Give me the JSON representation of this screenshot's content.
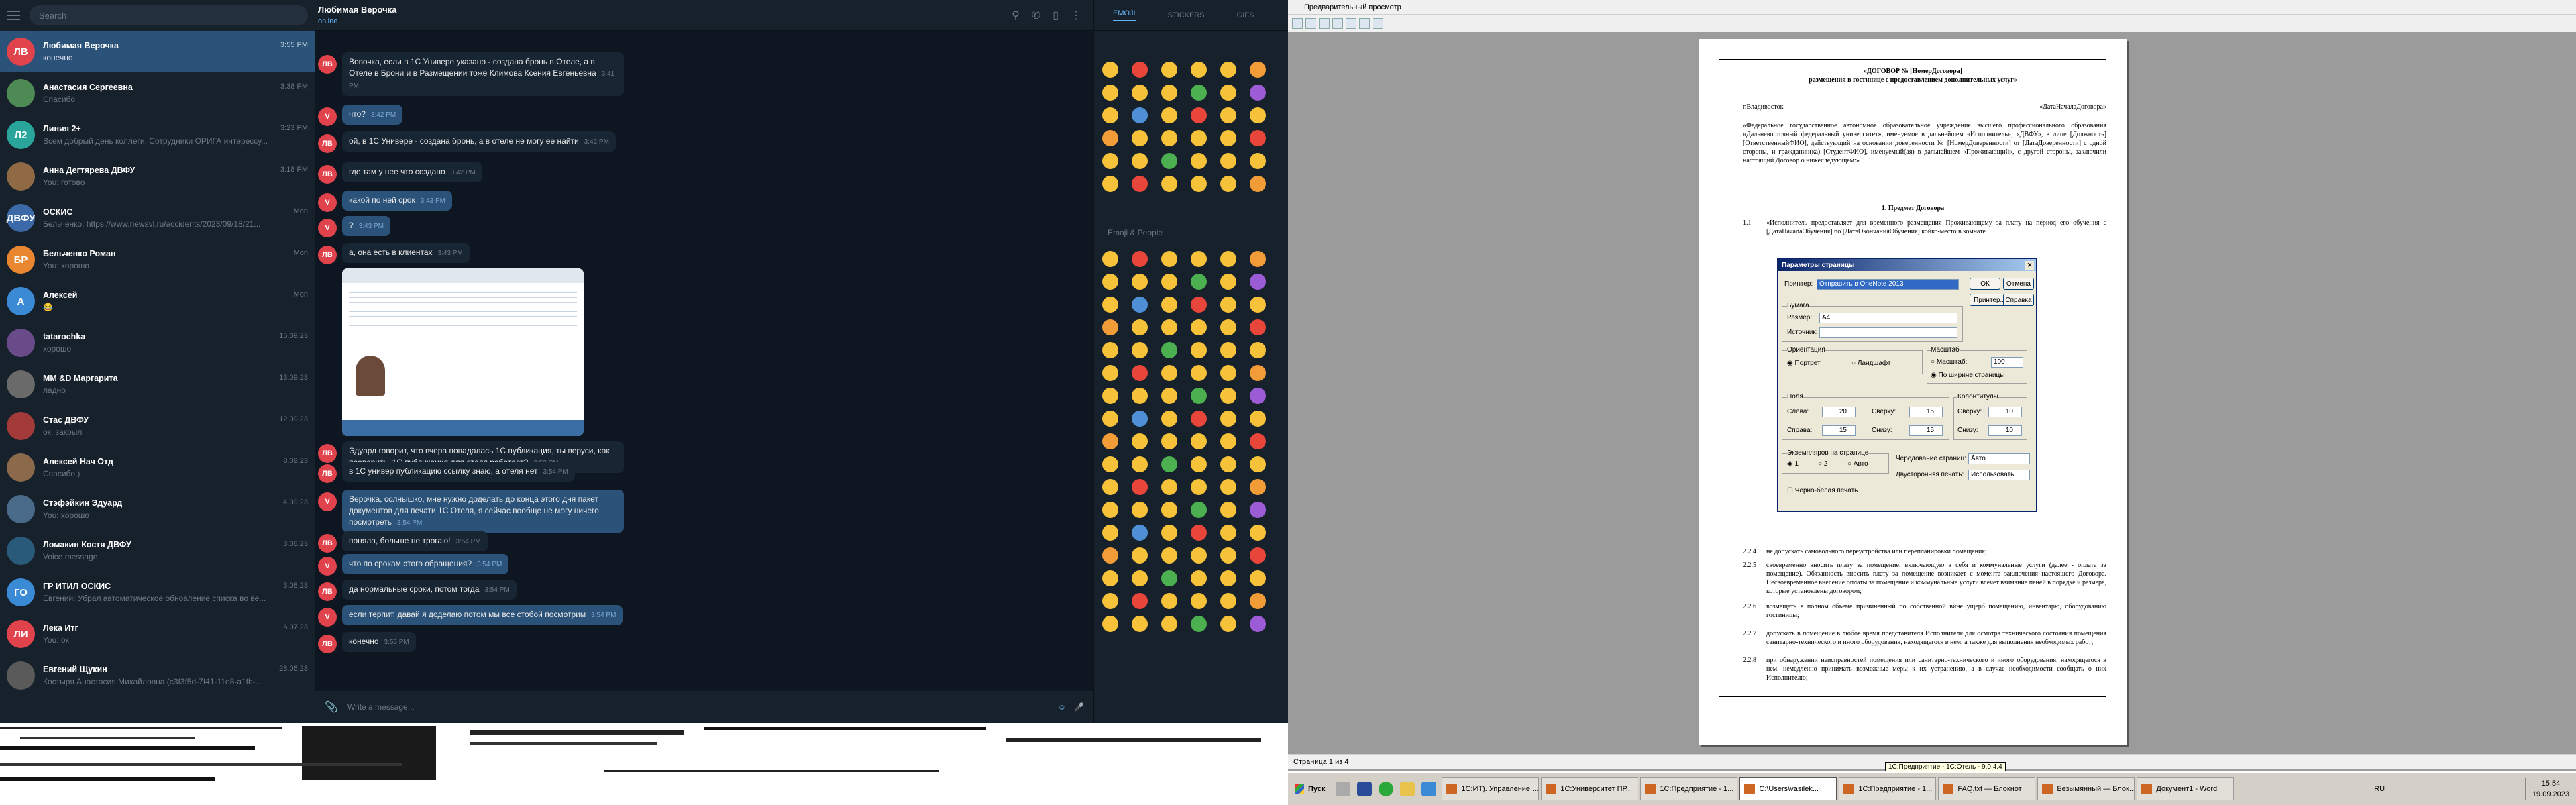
{
  "telegram": {
    "search_placeholder": "Search",
    "chats": [
      {
        "name": "Любимая Верочка",
        "time": "3:55 PM",
        "preview": "конечно",
        "avatar": "ЛВ",
        "color": "#e0434b",
        "active": true
      },
      {
        "name": "Анастасия Сергеевна",
        "time": "3:38 PM",
        "preview": "Спасибо",
        "avatar": "",
        "color": "#4e8a54"
      },
      {
        "name": "Линия 2+",
        "time": "3:23 PM",
        "preview": "Всем добрый день коллеги. Сотрудники ОРИГА интерессу...",
        "avatar": "Л2",
        "color": "#2aa59b"
      },
      {
        "name": "Анна Дегтярева ДВФУ",
        "time": "3:18 PM",
        "preview": "You: готово",
        "avatar": "",
        "color": "#8f6a44"
      },
      {
        "name": "ОСКИС",
        "time": "Mon",
        "preview": "Бельченко: https://www.newsvl.ru/accidents/2023/09/18/21...",
        "avatar": "ДВФУ",
        "color": "#3c6aa8"
      },
      {
        "name": "Бельченко Роман",
        "time": "Mon",
        "preview": "You: хорошо",
        "avatar": "БР",
        "color": "#e8872f"
      },
      {
        "name": "Алексей",
        "time": "Mon",
        "preview": "😂",
        "avatar": "А",
        "color": "#3a8ad6"
      },
      {
        "name": "tatarochka",
        "time": "15.09.23",
        "preview": "хорошо",
        "avatar": "",
        "color": "#6a4b8a"
      },
      {
        "name": "ММ &D Маргарита",
        "time": "13.09.23",
        "preview": "ладно",
        "avatar": "",
        "color": "#6a6a6a"
      },
      {
        "name": "Стас ДВФУ",
        "time": "12.09.23",
        "preview": "ок, закрыл",
        "avatar": "",
        "color": "#a23a3a"
      },
      {
        "name": "Алексей Нач Отд",
        "time": "8.09.23",
        "preview": "Спасибо )",
        "avatar": "",
        "color": "#8a6a4a"
      },
      {
        "name": "Стэфэйкин Эдуард",
        "time": "4.09.23",
        "preview": "You: хорошо",
        "avatar": "",
        "color": "#4a6a8a"
      },
      {
        "name": "Ломакин Костя ДВФУ",
        "time": "3.08.23",
        "preview": "Voice message",
        "avatar": "",
        "color": "#2a5a7a"
      },
      {
        "name": "ГР ИТИЛ ОСКИС",
        "time": "3.08.23",
        "preview": "Евгений: Убрал автоматическое обновление списка во ве...",
        "avatar": "ГО",
        "color": "#3a8ad6"
      },
      {
        "name": "Лека Итг",
        "time": "6.07.23",
        "preview": "You: ок",
        "avatar": "ЛИ",
        "color": "#e0434b"
      },
      {
        "name": "Евгений Щукин",
        "time": "28.06.23",
        "preview": "Костыря Анастасия Михайловна (c3f3f5d-7f41-11e8-a1fb-...",
        "avatar": "",
        "color": "#5a5a5a"
      }
    ],
    "header": {
      "name": "Любимая Верочка",
      "status": "online"
    },
    "messages": [
      {
        "dir": "in",
        "text": "Вовочка, если в 1С Универе указано - создана бронь в Отеле, а в Отеле в Брони и в Размещении тоже Климова Ксения Евгеньевна",
        "time": "3:41 PM"
      },
      {
        "dir": "out",
        "text": "что?",
        "time": "3:42 PM"
      },
      {
        "dir": "in",
        "text": "ой, в 1С Универе - создана бронь, а в отеле не могу ее найти",
        "time": "3:42 PM"
      },
      {
        "dir": "in",
        "text": "где там у нее что создано",
        "time": "3:42 PM"
      },
      {
        "dir": "out",
        "text": "какой по ней срок",
        "time": "3:43 PM"
      },
      {
        "dir": "out",
        "text": "?",
        "time": "3:43 PM"
      },
      {
        "dir": "in",
        "text": "а, она есть в клиентах",
        "time": "3:43 PM"
      },
      {
        "dir": "in",
        "text": "Эдуард говорит, что вчера попадалась 1С публикация, ты веруси, как проверить, 1С публикация для отеля работает?",
        "time": "3:53 PM"
      },
      {
        "dir": "in",
        "text": "в 1С универ публикацию ссылку знаю, а отеля нет",
        "time": "3:54 PM"
      },
      {
        "dir": "out",
        "text": "Верочка, солнышко, мне нужно доделать до конца этого дня пакет документов для печати 1С Отеля, я сейчас вообще не могу ничего посмотреть",
        "time": "3:54 PM"
      },
      {
        "dir": "in",
        "text": "поняла, больше не трогаю!",
        "time": "3:54 PM"
      },
      {
        "dir": "out",
        "text": "что по срокам этого обращения?",
        "time": "3:54 PM"
      },
      {
        "dir": "in",
        "text": "да нормальные сроки, потом тогда",
        "time": "3:54 PM"
      },
      {
        "dir": "out",
        "text": "если терпит, давай я доделаю потом мы все стобой посмотрим",
        "time": "3:54 PM"
      },
      {
        "dir": "in",
        "text": "конечно",
        "time": "3:55 PM"
      }
    ],
    "composer_placeholder": "Write a message...",
    "emoji_tabs": [
      "EMOJI",
      "STICKERS",
      "GIFS"
    ],
    "emoji_section": "Emoji & People"
  },
  "preview": {
    "window_title": "Предварительный просмотр",
    "doc_heading": "«ДОГОВОР № [НомерДоговора]",
    "doc_subheading": "размещения в гостинице с предоставлением дополнительных услуг»",
    "doc_city": "г.Владивосток",
    "doc_date": "«ДатаНачалаДоговора»",
    "doc_intro": "«Федеральное государственное автономное образовательное учреждение высшего профессионального образования «Дальневосточный федеральный университет», именуемое в дальнейшем «Исполнитель», «ДВФУ», в лице [Должность] [ОтветственныйФИО], действующий на основании доверенности № [НомерДоверенности] от [ДатаДоверенности] с одной стороны, и гражданин(ка) [СтудентФИО], именуемый(ая) в дальнейшем «Проживающий», с другой стороны, заключили настоящий Договор о нижеследующем:»",
    "doc_section": "1. Предмет Договора",
    "doc_p11": "«Исполнитель предоставляет для временного размещения Проживающему за плату на период его обучения с [ДатаНачалаОбучения] по [ДатаОкончанияОбучения] койко-место в комнате",
    "doc_items": [
      {
        "n": "2.2.4",
        "t": "не допускать самовольного переустройства или перепланировки помещения;"
      },
      {
        "n": "2.2.5",
        "t": "своевременно вносить плату за помещение, включающую в себя и коммунальные услуги (далее - оплата за помещение). Обязанность вносить плату за помещение возникает с момента заключения настоящего Договора. Несвоевременное внесение оплаты за помещение и коммунальные услуги влечет взимание пеней в порядке и размере, которые установлены договором;"
      },
      {
        "n": "2.2.6",
        "t": "возмещать в полном объеме причиненный по собственной вине ущерб помещению, инвентарю, оборудованию гостиницы;"
      },
      {
        "n": "2.2.7",
        "t": "допускать в помещение в любое время представителя Исполнителя для осмотра технического состояния помещения санитарно-технического и иного оборудования, находящегося в нем, а также для выполнения необходимых работ;"
      },
      {
        "n": "2.2.8",
        "t": "при обнаружении неисправностей помещения или санитарно-технического и иного оборудования, находящегося в нем, немедленно принимать возможные меры к их устранению, а в случае необходимости сообщать о них Исполнителю;"
      }
    ],
    "status": "Страница 1 из 4",
    "dialog": {
      "title": "Параметры страницы",
      "printer_label": "Принтер:",
      "printer_value": "Отправить в OneNote 2013",
      "ok": "ОК",
      "cancel": "Отмена",
      "printer_btn": "Принтер...",
      "help": "Справка",
      "paper_group": "Бумага",
      "size_label": "Размер:",
      "size_value": "A4",
      "source_label": "Источник:",
      "orient_group": "Ориентация",
      "portrait": "Портрет",
      "landscape": "Ландшафт",
      "scale_group": "Масштаб",
      "scale_label": "Масштаб:",
      "scale_value": "100",
      "fit_width": "По ширине страницы",
      "fields_group": "Поля",
      "left_label": "Слева:",
      "left_value": "20",
      "top_label": "Сверху:",
      "top_value": "15",
      "right_label": "Справа:",
      "right_value": "15",
      "bottom_label": "Снизу:",
      "bottom_value": "15",
      "hf_group": "Колонтитулы",
      "header_label": "Сверху:",
      "header_value": "10",
      "footer_label": "Снизу:",
      "footer_value": "10",
      "copies_group": "Экземпляров на странице",
      "c1": "1",
      "c2": "2",
      "cauto": "Авто",
      "alt_label": "Чередование страниц:",
      "alt_value": "Авто",
      "duplex_label": "Двусторонняя печать:",
      "duplex_value": "Использовать настрой",
      "bw_label": "Черно-белая печать"
    }
  },
  "taskbar": {
    "start": "Пуск",
    "buttons": [
      "1С:ИТ). Управление ...",
      "1С:Университет ПР...",
      "1С:Предприятие - 1...",
      "C:\\Users\\vasilek...",
      "1С:Предприятие - 1...",
      "FAQ.txt — Блокнот",
      "Безымянный — Блок...",
      "Документ1 - Word"
    ],
    "active_index": 3,
    "lang": "RU",
    "time": "15:54",
    "date": "19.09.2023",
    "tooltip": "1С:Предприятие - 1С:Отель - 9.0.4.4"
  },
  "colors": {
    "tg_bg": "#0e1621",
    "tg_panel": "#17212b",
    "tg_out": "#2b5278",
    "accent": "#64b5f6"
  }
}
